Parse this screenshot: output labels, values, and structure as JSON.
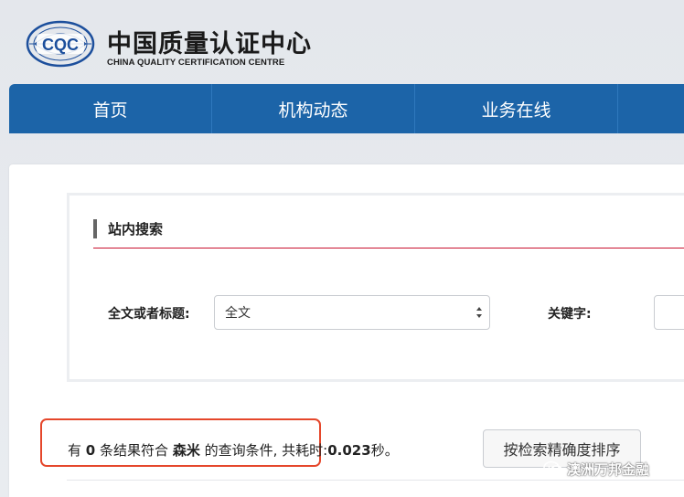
{
  "header": {
    "logo_text": "CQC",
    "brand_cn": "中国质量认证中心",
    "brand_en": "CHINA QUALITY CERTIFICATION CENTRE"
  },
  "nav": {
    "items": [
      {
        "label": "首页"
      },
      {
        "label": "机构动态"
      },
      {
        "label": "业务在线"
      },
      {
        "label": ""
      }
    ]
  },
  "search": {
    "title": "站内搜索",
    "scope_label": "全文或者标题:",
    "scope_value": "全文",
    "keyword_label": "关键字:",
    "keyword_value": ""
  },
  "result": {
    "prefix": "有",
    "count": "0",
    "middle": "条结果符合",
    "query": "森米",
    "suffix": "的查询条件,",
    "time_label": "共耗时:",
    "time_value": "0.023",
    "time_unit": "秒。"
  },
  "sort_button": {
    "label": "按检索精确度排序"
  },
  "watermark": {
    "text": "澳洲万邦金融"
  },
  "colors": {
    "nav_blue": "#1c64a8",
    "accent_red": "#c8102e",
    "highlight_box": "#e5472b"
  }
}
